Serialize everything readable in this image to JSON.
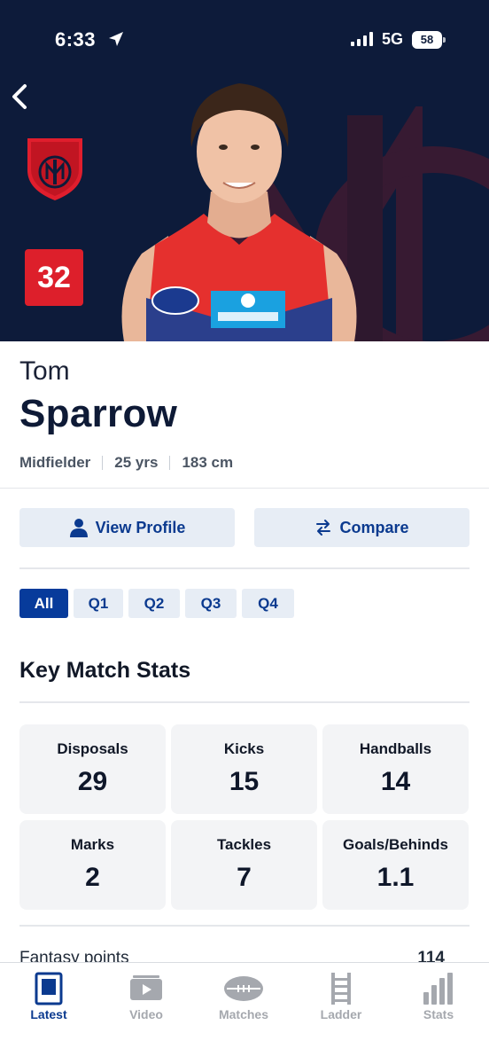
{
  "status_bar": {
    "time": "6:33",
    "network": "5G",
    "battery": "58"
  },
  "player": {
    "first_name": "Tom",
    "last_name": "Sparrow",
    "number": "32",
    "position": "Midfielder",
    "age": "25 yrs",
    "height": "183 cm",
    "club_logo_text": "MELBOURNE"
  },
  "actions": {
    "view_profile": "View Profile",
    "compare": "Compare"
  },
  "quarter_tabs": [
    {
      "label": "All",
      "active": true
    },
    {
      "label": "Q1",
      "active": false
    },
    {
      "label": "Q2",
      "active": false
    },
    {
      "label": "Q3",
      "active": false
    },
    {
      "label": "Q4",
      "active": false
    }
  ],
  "key_stats": {
    "title": "Key Match Stats",
    "items": [
      {
        "label": "Disposals",
        "value": "29"
      },
      {
        "label": "Kicks",
        "value": "15"
      },
      {
        "label": "Handballs",
        "value": "14"
      },
      {
        "label": "Marks",
        "value": "2"
      },
      {
        "label": "Tackles",
        "value": "7"
      },
      {
        "label": "Goals/Behinds",
        "value": "1.1"
      }
    ]
  },
  "fantasy": {
    "label": "Fantasy points",
    "value": "114"
  },
  "nav": {
    "items": [
      {
        "label": "Latest",
        "icon": "latest-icon",
        "active": true
      },
      {
        "label": "Video",
        "icon": "video-icon",
        "active": false
      },
      {
        "label": "Matches",
        "icon": "football-icon",
        "active": false
      },
      {
        "label": "Ladder",
        "icon": "ladder-icon",
        "active": false
      },
      {
        "label": "Stats",
        "icon": "bar-chart-icon",
        "active": false
      }
    ]
  },
  "colors": {
    "hero_bg": "#0d1b3a",
    "club_red": "#dd1f2b",
    "primary_blue": "#073b9b",
    "button_bg": "#e7edf5"
  }
}
